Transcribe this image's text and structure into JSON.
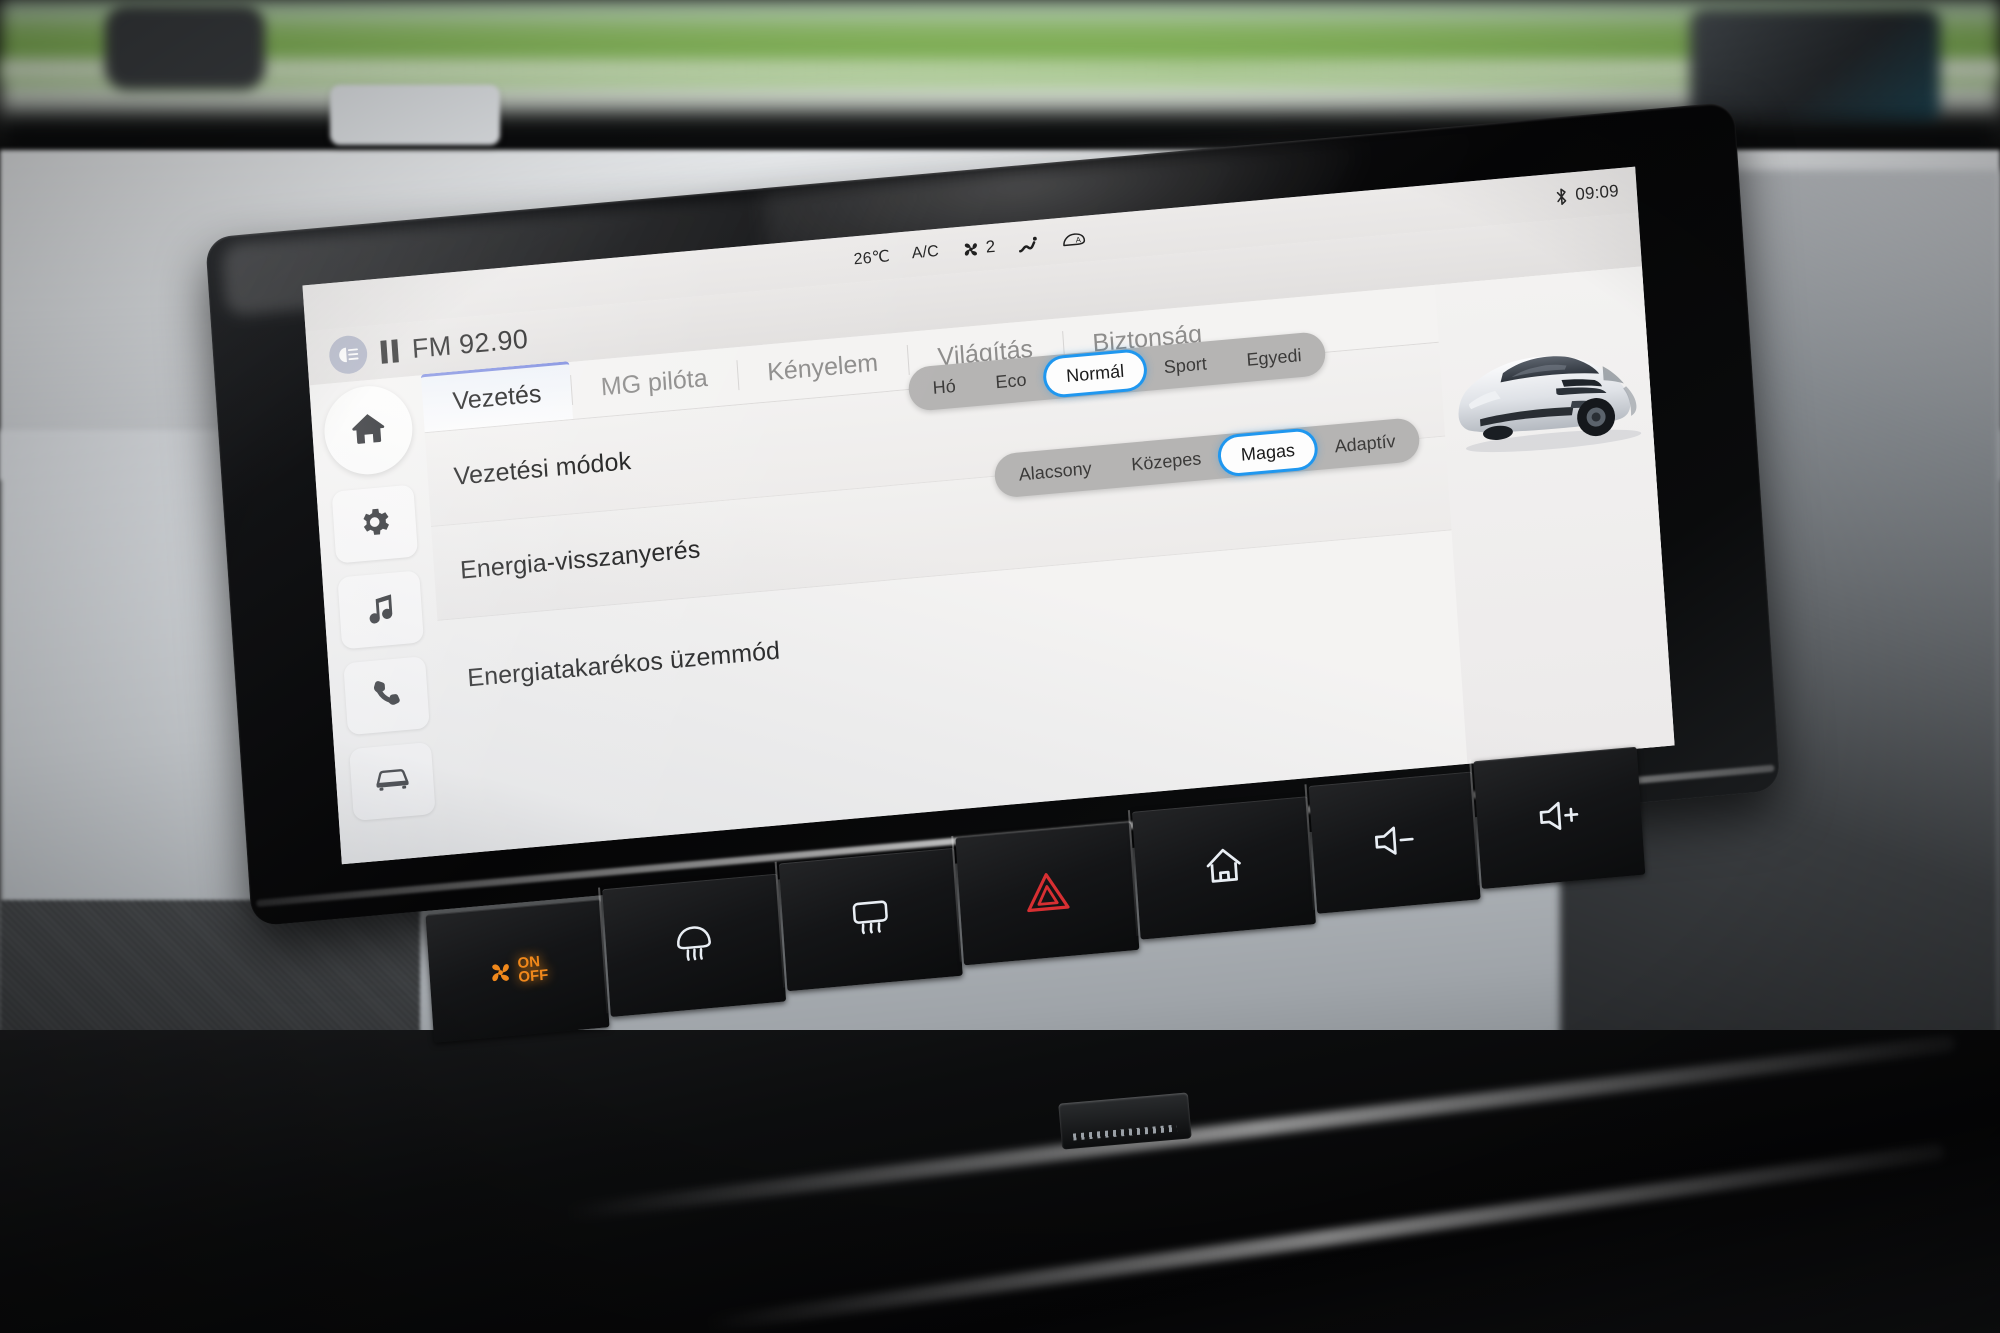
{
  "status_bar": {
    "temperature": "26℃",
    "ac_label": "A/C",
    "fan_speed": "2",
    "airflow_icon": "airflow-icon",
    "defrost_icon": "windshield-defrost-icon",
    "bluetooth_icon": "bluetooth-icon",
    "clock": "09:09"
  },
  "media_bar": {
    "source_icon": "radio-signal-icon",
    "playback_state_icon": "pause-icon",
    "now_playing": "FM 92.90"
  },
  "sidebar": {
    "items": [
      {
        "name": "home",
        "icon": "home-icon",
        "active": true
      },
      {
        "name": "settings",
        "icon": "gear-icon",
        "active": false
      },
      {
        "name": "media",
        "icon": "music-note-icon",
        "active": false
      },
      {
        "name": "phone",
        "icon": "phone-icon",
        "active": false
      },
      {
        "name": "vehicle",
        "icon": "car-icon",
        "active": false
      }
    ]
  },
  "tabs": [
    {
      "label": "Vezetés",
      "active": true
    },
    {
      "label": "MG pilóta",
      "active": false
    },
    {
      "label": "Kényelem",
      "active": false
    },
    {
      "label": "Világítás",
      "active": false
    },
    {
      "label": "Biztonság",
      "active": false
    }
  ],
  "settings": {
    "rows": [
      {
        "label": "Vezetési módok"
      },
      {
        "label": "Energia-visszanyerés"
      },
      {
        "label": "Energiatakarékos üzemmód"
      }
    ],
    "drive_modes": {
      "options": [
        "Hó",
        "Eco",
        "Normál",
        "Sport",
        "Egyedi"
      ],
      "selected": "Normál"
    },
    "regen_levels": {
      "options": [
        "Alacsony",
        "Közepes",
        "Magas",
        "Adaptív"
      ],
      "selected": "Magas"
    },
    "eco_toggle": {
      "state": "off"
    }
  },
  "vehicle_image": {
    "name": "mg4-electric-hatchback",
    "color": "#e9ebee"
  },
  "hardware_buttons": [
    {
      "name": "climate-power",
      "icon": "fan-icon",
      "label_top": "ON",
      "label_bottom": "OFF",
      "illuminated": true
    },
    {
      "name": "front-defrost",
      "icon": "front-defrost-icon",
      "illuminated": false
    },
    {
      "name": "rear-defrost",
      "icon": "rear-defrost-icon",
      "illuminated": false
    },
    {
      "name": "hazard-lights",
      "icon": "hazard-triangle-icon",
      "illuminated": false
    },
    {
      "name": "home",
      "icon": "home-outline-icon",
      "illuminated": false
    },
    {
      "name": "volume-down",
      "icon": "volume-down-icon",
      "illuminated": false
    },
    {
      "name": "volume-up",
      "icon": "volume-up-icon",
      "illuminated": false
    }
  ],
  "colors": {
    "accent_blue": "#1f97ef",
    "tab_underline": "#7f8ee0",
    "hazard_red": "#d72f32",
    "fan_amber": "#f0881c",
    "screen_bg": "#f4f3f2",
    "segment_track": "#b5b4b3"
  }
}
